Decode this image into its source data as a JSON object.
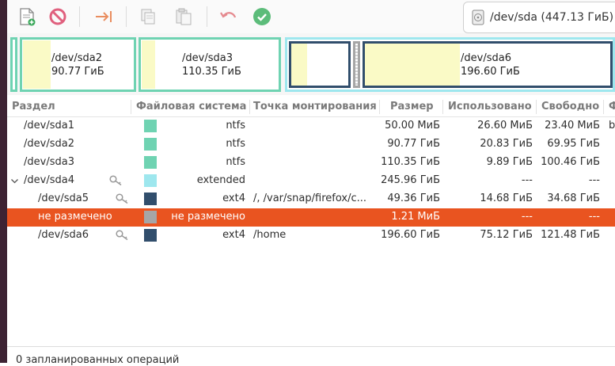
{
  "device": {
    "label": "/dev/sda (447.13 ГиБ)"
  },
  "colors": {
    "ntfs": "#6fd3b2",
    "extended": "#9ee7ee",
    "ext4": "#314e6c",
    "unallocated": "#a6a6a6",
    "used_fill": "#fafac6",
    "accent": "#e95420"
  },
  "map": {
    "sda2": {
      "name": "/dev/sda2",
      "size": "90.77 ГиБ"
    },
    "sda3": {
      "name": "/dev/sda3",
      "size": "110.35 ГиБ"
    },
    "sda6": {
      "name": "/dev/sda6",
      "size": "196.60 ГиБ"
    }
  },
  "columns": {
    "partition": "Раздел",
    "filesystem": "Файловая система",
    "mountpoint": "Точка монтирования",
    "size": "Размер",
    "used": "Использовано",
    "free": "Свободно",
    "flags": "Ф"
  },
  "rows": [
    {
      "name": "/dev/sda1",
      "fs": "ntfs",
      "mount": "",
      "size": "50.00 МиБ",
      "used": "26.60 МиБ",
      "free": "23.40 МиБ",
      "flags": "b"
    },
    {
      "name": "/dev/sda2",
      "fs": "ntfs",
      "mount": "",
      "size": "90.77 ГиБ",
      "used": "20.83 ГиБ",
      "free": "69.95 ГиБ",
      "flags": ""
    },
    {
      "name": "/dev/sda3",
      "fs": "ntfs",
      "mount": "",
      "size": "110.35 ГиБ",
      "used": "9.89 ГиБ",
      "free": "100.46 ГиБ",
      "flags": ""
    },
    {
      "name": "/dev/sda4",
      "fs": "extended",
      "mount": "",
      "size": "245.96 ГиБ",
      "used": "---",
      "free": "---",
      "flags": ""
    },
    {
      "name": "/dev/sda5",
      "fs": "ext4",
      "mount": "/, /var/snap/firefox/c...",
      "size": "49.36 ГиБ",
      "used": "14.68 ГиБ",
      "free": "34.68 ГиБ",
      "flags": ""
    },
    {
      "name": "не размечено",
      "fs": "не размечено",
      "mount": "",
      "size": "1.21 МиБ",
      "used": "---",
      "free": "---",
      "flags": ""
    },
    {
      "name": "/dev/sda6",
      "fs": "ext4",
      "mount": "/home",
      "size": "196.60 ГиБ",
      "used": "75.12 ГиБ",
      "free": "121.48 ГиБ",
      "flags": ""
    }
  ],
  "status": "0 запланированных операций"
}
